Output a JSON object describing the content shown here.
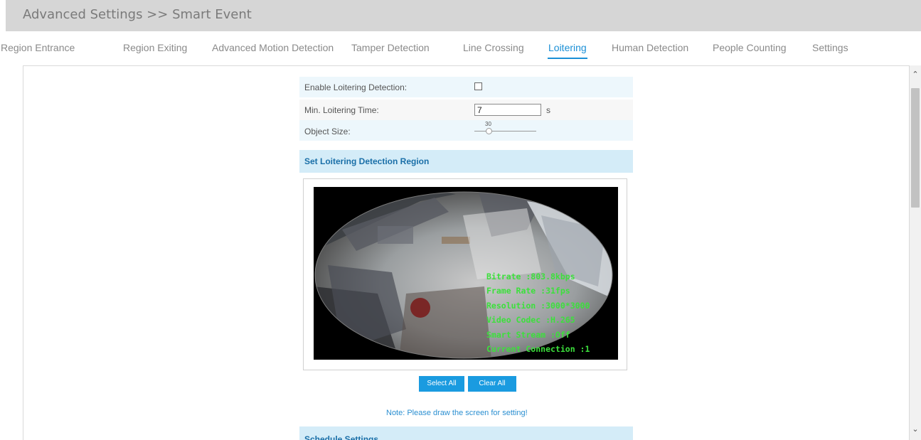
{
  "header": {
    "breadcrumb": "Advanced Settings >> Smart Event"
  },
  "tabs": [
    {
      "label": "Region Entrance"
    },
    {
      "label": "Region Exiting"
    },
    {
      "label": "Advanced Motion Detection"
    },
    {
      "label": "Tamper Detection"
    },
    {
      "label": "Line Crossing"
    },
    {
      "label": "Loitering"
    },
    {
      "label": "Human Detection"
    },
    {
      "label": "People Counting"
    },
    {
      "label": "Settings"
    }
  ],
  "active_tab": "Loitering",
  "form": {
    "enable_label": "Enable Loitering Detection:",
    "enable_checked": false,
    "min_time_label": "Min. Loitering Time:",
    "min_time_value": "7",
    "min_time_unit": "s",
    "object_size_label": "Object Size:",
    "object_size_value": "30"
  },
  "region_section": {
    "title": "Set Loitering Detection Region"
  },
  "video_osd": [
    "Bitrate :803.8kbps",
    "Frame Rate :31fps",
    "Resolution :3000*3000",
    "Video Codec :H.265",
    "Smart Stream :Off",
    "Current Connection :1"
  ],
  "buttons": {
    "select_all": "Select All",
    "clear_all": "Clear All"
  },
  "note": "Note: Please draw the screen for setting!",
  "schedule_section": {
    "title": "Schedule Settings"
  },
  "colors": {
    "accent": "#1a9be0",
    "tab_active": "#1a8fd6",
    "osd_text": "#3ce03c"
  }
}
